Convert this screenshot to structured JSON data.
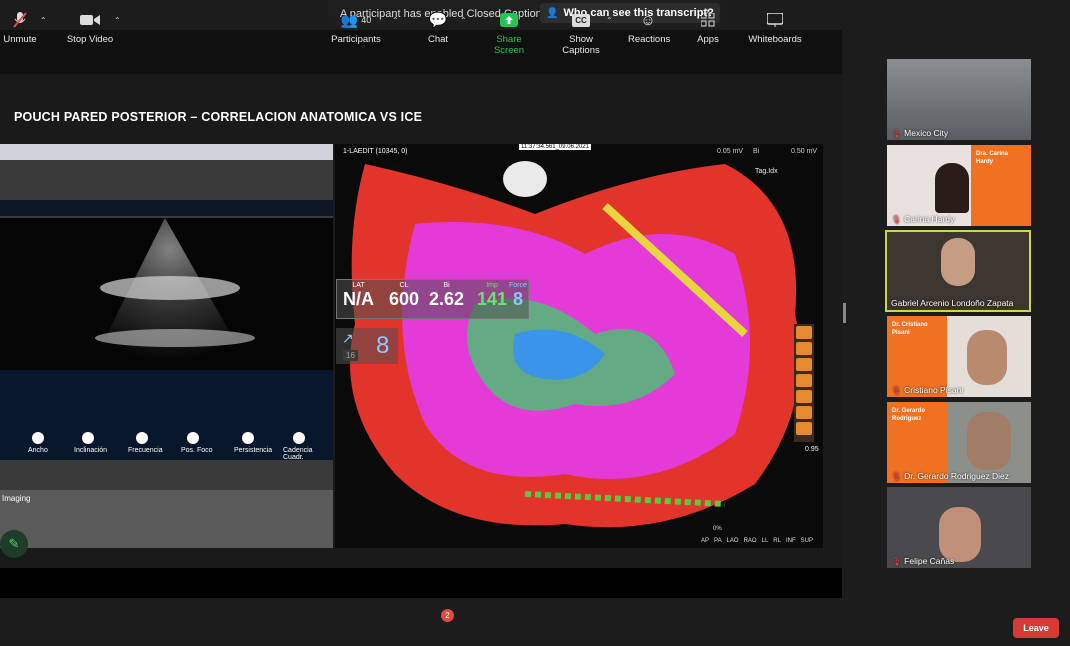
{
  "banner": {
    "message": "A participant has enabled Closed Captioning",
    "link": "Who can see this transcript?",
    "close": "×"
  },
  "slide": {
    "title": "POUCH PARED POSTERIOR – CORRELACION ANATOMICA VS ICE",
    "echo_imaging_label": "Imaging",
    "echo_controls": [
      "Ancho",
      "Inclinación",
      "Frecuencia",
      "Pos. Foco",
      "Persistencia",
      "Cadencia Cuadr."
    ],
    "map_header": "1-LAEDIT (10345, 0)",
    "map_timestamp": "11:37:34.561_09.06.2021",
    "map_scale_low": "0.05 mV",
    "map_scale_high": "0.50 mV",
    "map_scale_mode": "Bi",
    "map_tag": "Tag.Idx",
    "stats": {
      "labels": [
        "LAT",
        "CL",
        "Bi",
        "Imp",
        "Force"
      ],
      "values": [
        "N/A",
        "600",
        "2.62",
        "141",
        "8"
      ],
      "force_big": "8"
    },
    "side_number": "16",
    "map_zoom": "0%",
    "view_buttons": [
      "AP",
      "PA",
      "LAO",
      "RAO",
      "LL",
      "RL",
      "INF",
      "SUP"
    ],
    "scale_max": "0.95"
  },
  "participants_tiles": [
    {
      "name": "Mexico City"
    },
    {
      "name": "Carina Hardy",
      "card": [
        "Dra. Carina",
        "Hardy"
      ]
    },
    {
      "name": "Gabriel Arcenio Londoño Zapata",
      "active": true
    },
    {
      "name": "Cristiano Pisani",
      "card": [
        "Dr. Cristiano",
        "Pisani"
      ]
    },
    {
      "name": "Dr. Gerardo Rodriguez Diez",
      "card": [
        "Dr. Gerardo",
        "Rodriguez"
      ]
    },
    {
      "name": "Felipe Cañas"
    }
  ],
  "toolbar": {
    "unmute": "Unmute",
    "stop_video": "Stop Video",
    "participants": "Participants",
    "participants_count": "40",
    "chat": "Chat",
    "chat_badge": "2",
    "share_screen": "Share Screen",
    "show_captions": "Show Captions",
    "reactions": "Reactions",
    "apps": "Apps",
    "whiteboards": "Whiteboards",
    "leave": "Leave"
  },
  "colors": {
    "accent_green": "#23c552",
    "leave_red": "#d63b37",
    "active_border": "#c8d94a",
    "orange": "#f07122"
  }
}
